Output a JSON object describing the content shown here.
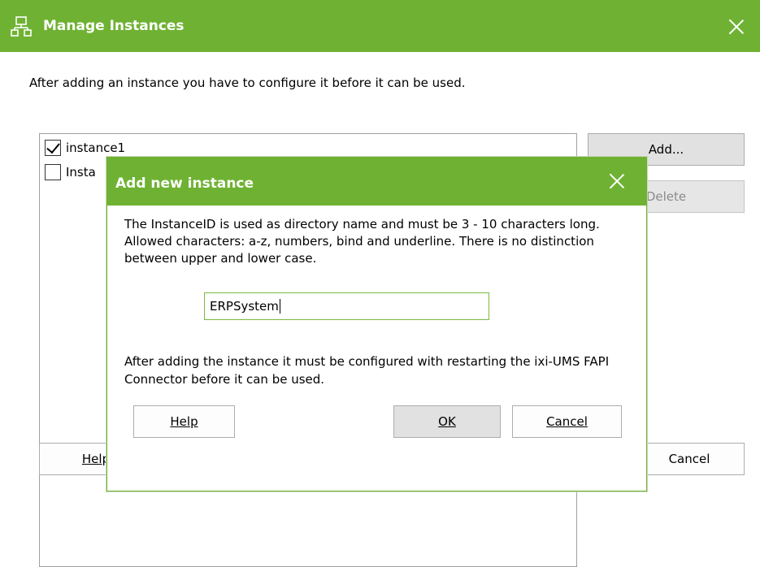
{
  "main_window": {
    "title": "Manage Instances",
    "intro": "After adding an instance you have to configure it before it can be used.",
    "instances": [
      {
        "label": "instance1",
        "checked": true
      },
      {
        "label": "Insta",
        "checked": false
      }
    ],
    "buttons": {
      "add": "Add...",
      "delete": "Delete",
      "help": "Help",
      "cancel": "Cancel"
    }
  },
  "dialog": {
    "title": "Add new instance",
    "description": "The InstanceID is used as directory name and must be 3 - 10 characters long. Allowed characters: a-z, numbers, bind and underline. There is no distinction between upper and lower case.",
    "instance_id_value": "ERPSystem",
    "note": "After adding the instance it must be configured with restarting the ixi-UMS FAPI Connector before it can be used.",
    "buttons": {
      "help": "Help",
      "ok": "OK",
      "cancel": "Cancel"
    }
  },
  "colors": {
    "titlebar": "#6fb233",
    "input_border": "#79bb42"
  }
}
